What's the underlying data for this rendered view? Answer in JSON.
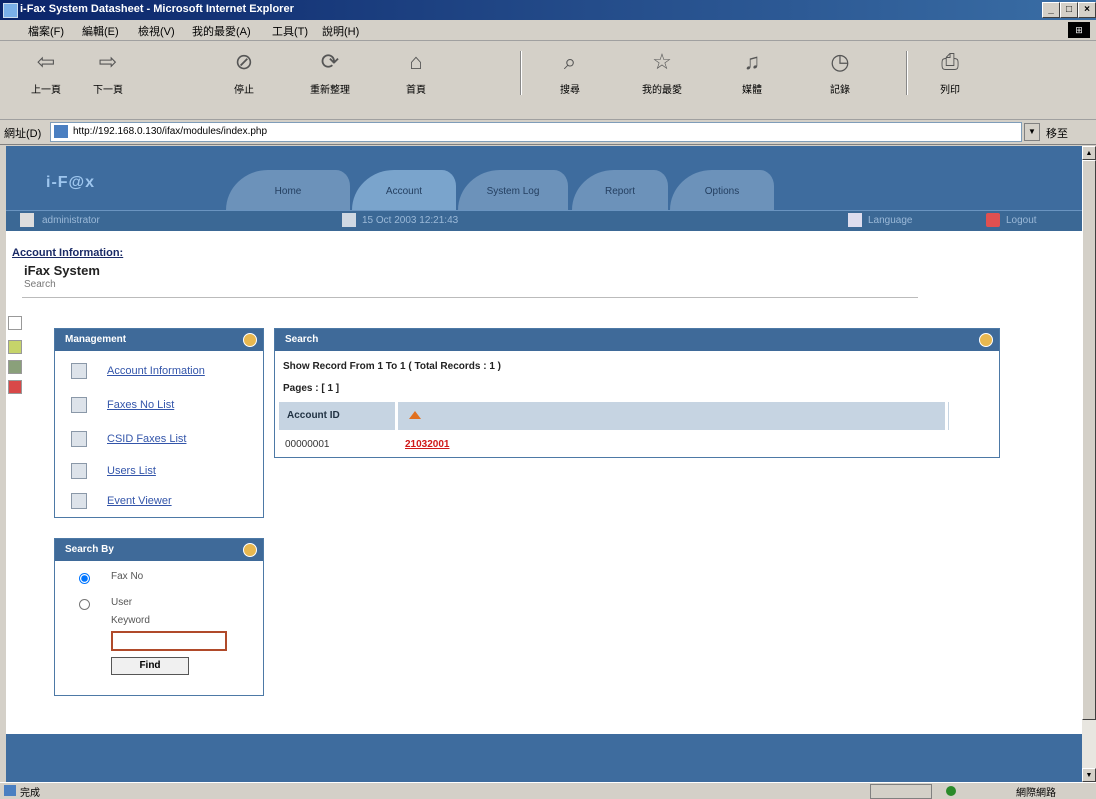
{
  "window": {
    "title": "i-Fax System Datasheet - Microsoft Internet Explorer",
    "buttons": {
      "minimize": "_",
      "maximize": "□",
      "close": "×"
    }
  },
  "menu": [
    "檔案(F)",
    "編輯(E)",
    "檢視(V)",
    "我的最愛(A)",
    "工具(T)",
    "說明(H)"
  ],
  "toolbar": {
    "back": "上一頁",
    "forward": "下一頁",
    "stop": "停止",
    "refresh": "重新整理",
    "home": "首頁",
    "search": "搜尋",
    "favorites": "我的最愛",
    "history": "媒體",
    "mail": "記錄",
    "print": "列印"
  },
  "address": {
    "label": "網址(D)",
    "url": "http://192.168.0.130/ifax/modules/index.php",
    "go": "移至"
  },
  "app": {
    "logo": "i-F@x",
    "tabs": [
      "Home",
      "Account",
      "System Log",
      "Report",
      "Options"
    ],
    "active_tab": "Account",
    "user": "administrator",
    "datetime": "15 Oct 2003 12:21:43",
    "language": "Language",
    "logout": "Logout"
  },
  "page": {
    "section": "Account Information:",
    "title": "iFax System",
    "subtitle": "Search"
  },
  "management": {
    "title": "Management",
    "items": [
      "Account Information",
      "Faxes No List",
      "CSID Faxes List",
      "Users List",
      "Event Viewer"
    ]
  },
  "searchby": {
    "title": "Search By",
    "options": [
      "Fax No",
      "User"
    ],
    "selected": "Fax No",
    "keyword_label": "Keyword",
    "keyword_value": "",
    "find_label": "Find"
  },
  "results": {
    "title": "Search",
    "summary": "Show Record From 1 To 1   ( Total Records : 1 )",
    "pages": "Pages : [ 1 ]",
    "column": "Account ID",
    "rows": [
      {
        "id": "00000001",
        "value": "21032001"
      }
    ]
  },
  "statusbar": {
    "text": "完成",
    "zone": "網際網路"
  }
}
